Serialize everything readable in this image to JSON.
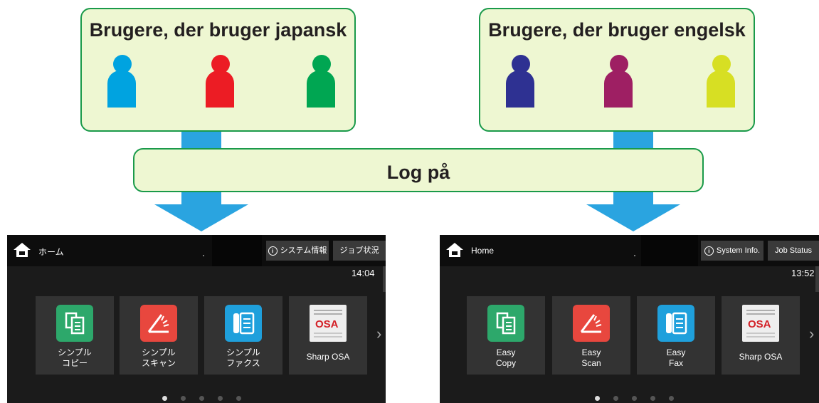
{
  "groups": {
    "japanese": {
      "title": "Brugere, der bruger japansk",
      "user_colors": [
        "#00a3e0",
        "#ec1c24",
        "#00a652"
      ]
    },
    "english": {
      "title": "Brugere, der bruger engelsk",
      "user_colors": [
        "#2e3192",
        "#9e1f63",
        "#d7df23"
      ]
    }
  },
  "login": {
    "label": "Log på"
  },
  "colors": {
    "arrow": "#2aa4e0",
    "box_fill": "#eef7d2",
    "box_border": "#1a9a4a"
  },
  "screens": {
    "japanese": {
      "home_label": "ホーム",
      "system_info_label": "システム情報",
      "job_status_label": "ジョブ状況",
      "time": "14:04",
      "tiles": [
        {
          "label": "シンプル\nコピー",
          "icon": "copy-icon"
        },
        {
          "label": "シンプル\nスキャン",
          "icon": "scan-icon"
        },
        {
          "label": "シンプル\nファクス",
          "icon": "fax-icon"
        },
        {
          "label": "Sharp OSA",
          "icon": "osa-icon"
        }
      ]
    },
    "english": {
      "home_label": "Home",
      "system_info_label": "System Info.",
      "job_status_label": "Job Status",
      "time": "13:52",
      "tiles": [
        {
          "label": "Easy\nCopy",
          "icon": "copy-icon"
        },
        {
          "label": "Easy\nScan",
          "icon": "scan-icon"
        },
        {
          "label": "Easy\nFax",
          "icon": "fax-icon"
        },
        {
          "label": "Sharp OSA",
          "icon": "osa-icon"
        }
      ]
    }
  },
  "pager": {
    "pages": 5,
    "active": 1
  }
}
